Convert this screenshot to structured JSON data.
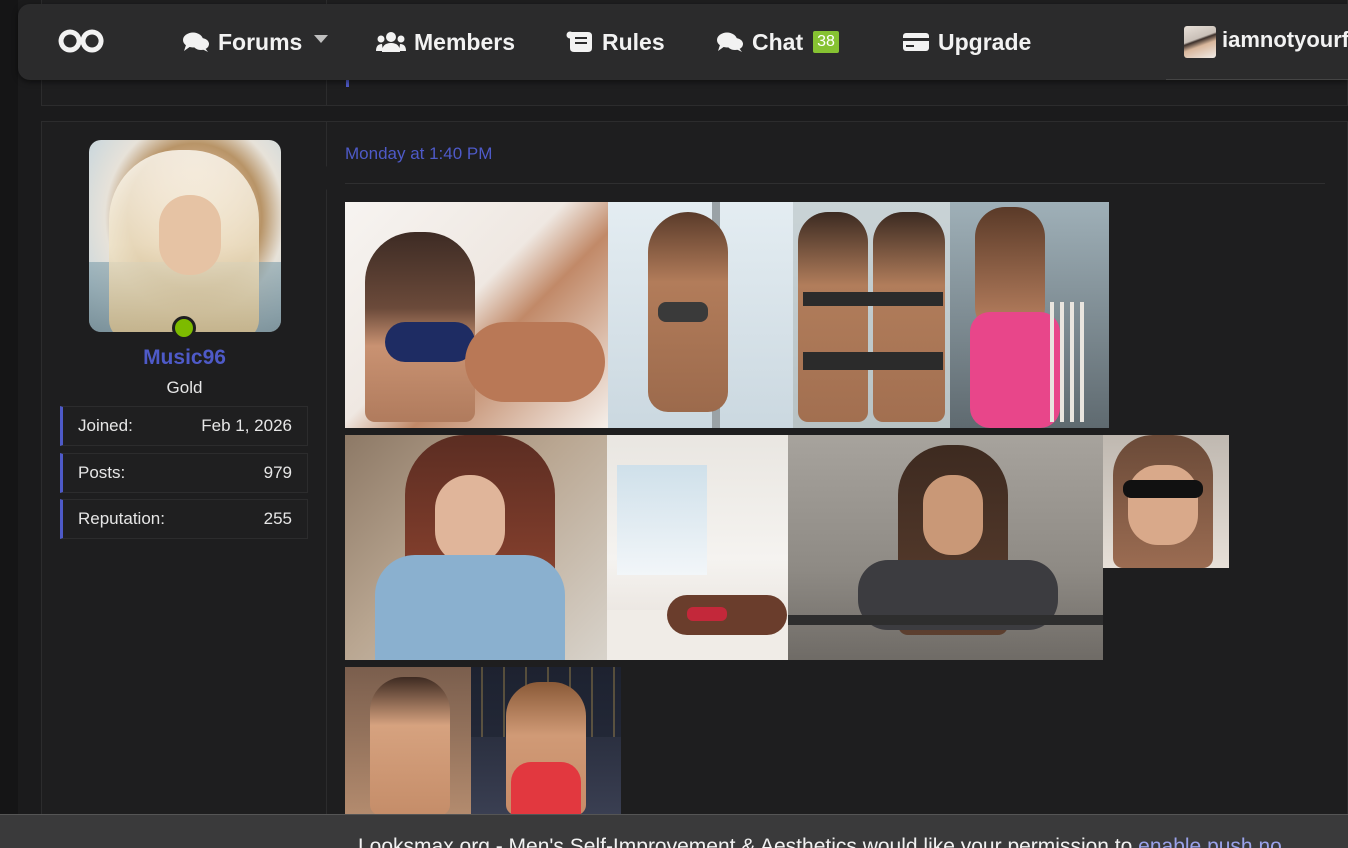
{
  "navbar": {
    "items": [
      {
        "label": "Forums",
        "icon": "comments-icon"
      },
      {
        "label": "Members",
        "icon": "users-icon"
      },
      {
        "label": "Rules",
        "icon": "scroll-icon"
      },
      {
        "label": "Chat",
        "icon": "comments-icon",
        "badge": "38"
      },
      {
        "label": "Upgrade",
        "icon": "credit-card-icon"
      }
    ],
    "user": {
      "name": "iamnotyourf"
    }
  },
  "post": {
    "author": {
      "name": "Music96",
      "title": "Gold",
      "online": true,
      "stats": [
        {
          "label": "Joined:",
          "value": "Feb 1, 2026"
        },
        {
          "label": "Posts:",
          "value": "979"
        },
        {
          "label": "Reputation:",
          "value": "255"
        }
      ]
    },
    "date": "Monday at 1:40 PM"
  },
  "push_banner": {
    "text": "Looksmax.org - Men's Self-Improvement & Aesthetics would like your permission to ",
    "link": "enable push no"
  },
  "colors": {
    "accent": "#4e5ac8",
    "online": "#7dbb00",
    "badge": "#86c232",
    "background": "#1b1b1c"
  }
}
